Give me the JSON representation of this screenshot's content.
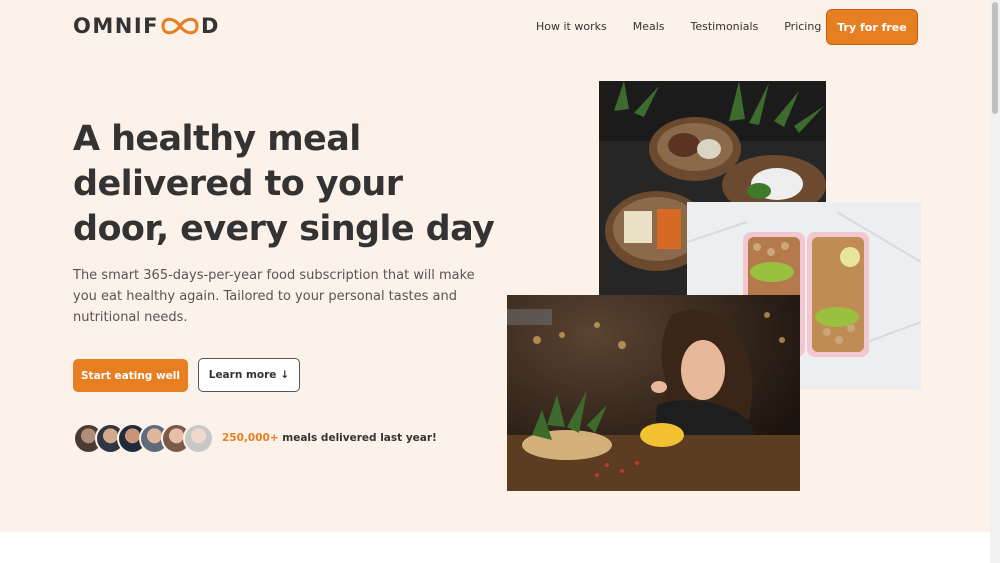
{
  "brand": {
    "logo_before": "OMNIF",
    "logo_after": "D",
    "accent": "#e67e22",
    "hero_bg": "#fdf2e9"
  },
  "nav": {
    "items": [
      "How it works",
      "Meals",
      "Testimonials",
      "Pricing"
    ],
    "cta": "Try for free"
  },
  "hero": {
    "title": "A healthy meal delivered to your door, every single day",
    "description": "The smart 365-days-per-year food subscription that will make you eat healthy again. Tailored to your personal tastes and nutritional needs.",
    "primary_button": "Start eating well",
    "secondary_button": "Learn more",
    "secondary_icon": "↓",
    "stats_number": "250,000+",
    "stats_text": " meals delivered last year!"
  }
}
